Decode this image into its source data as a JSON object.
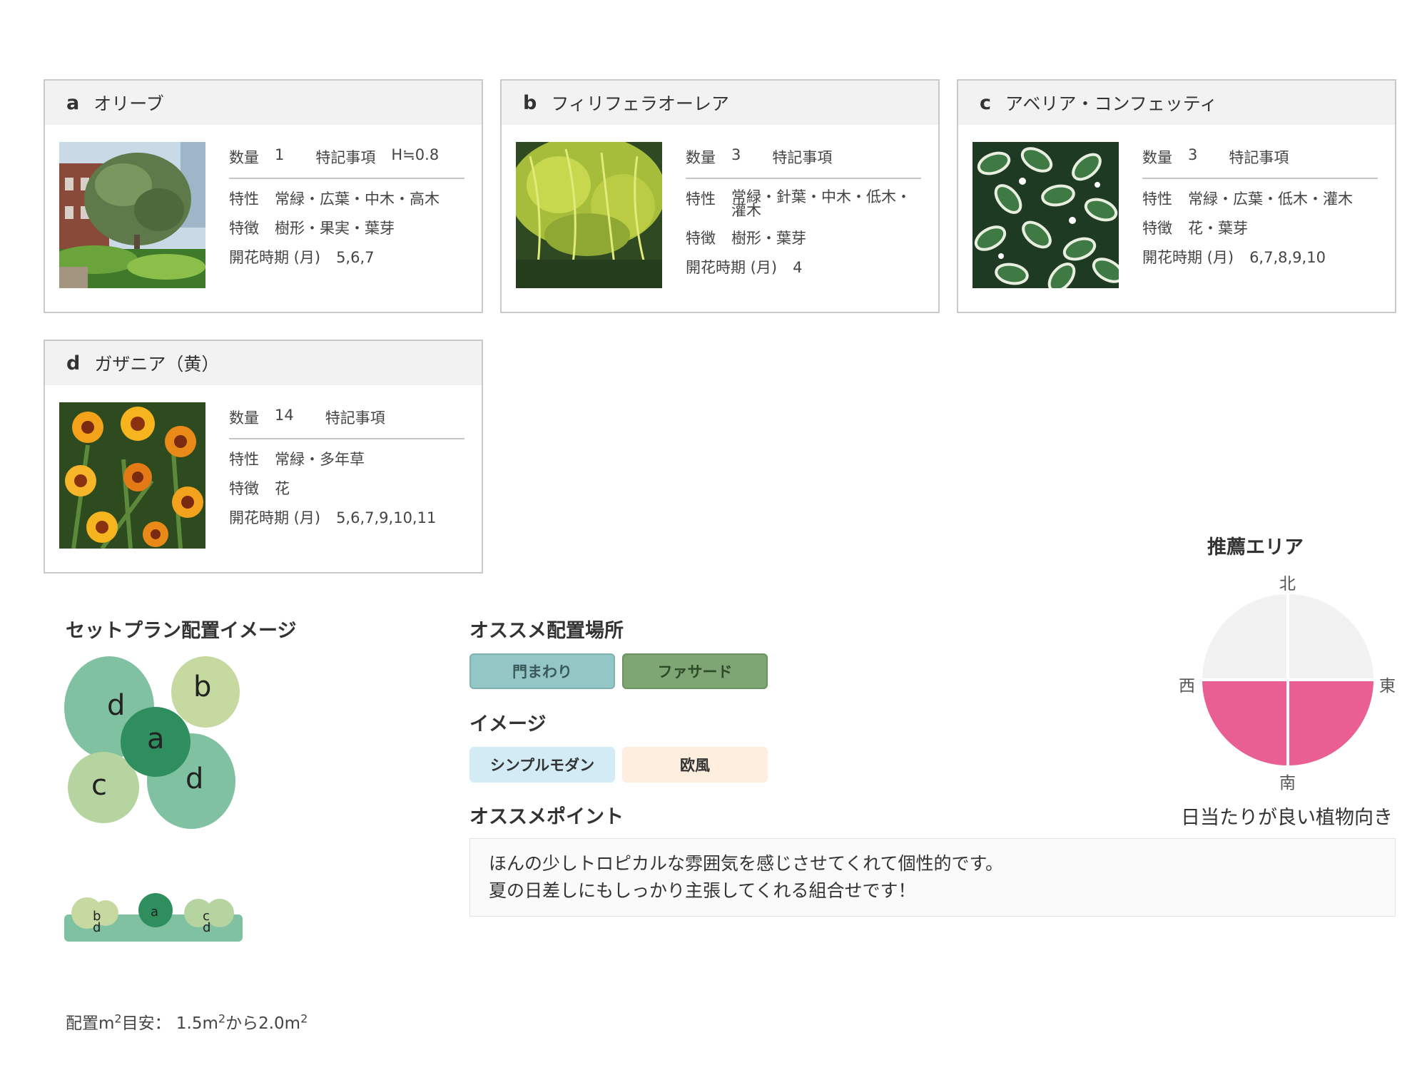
{
  "cards": [
    {
      "letter": "a",
      "name": "オリーブ",
      "qty_label": "数量",
      "qty": "1",
      "note_label": "特記事項",
      "note": "H≒0.8",
      "trait_label": "特性",
      "trait": "常緑・広葉・中木・高木",
      "feature_label": "特徴",
      "feature": "樹形・果実・葉芽",
      "bloom_label": "開花時期 (月)",
      "bloom": "5,6,7"
    },
    {
      "letter": "b",
      "name": "フィリフェラオーレア",
      "qty_label": "数量",
      "qty": "3",
      "note_label": "特記事項",
      "note": "",
      "trait_label": "特性",
      "trait": "常緑・針葉・中木・低木・灌木",
      "feature_label": "特徴",
      "feature": "樹形・葉芽",
      "bloom_label": "開花時期 (月)",
      "bloom": "4"
    },
    {
      "letter": "c",
      "name": "アベリア・コンフェッティ",
      "qty_label": "数量",
      "qty": "3",
      "note_label": "特記事項",
      "note": "",
      "trait_label": "特性",
      "trait": "常緑・広葉・低木・灌木",
      "feature_label": "特徴",
      "feature": "花・葉芽",
      "bloom_label": "開花時期 (月)",
      "bloom": "6,7,8,9,10"
    },
    {
      "letter": "d",
      "name": "ガザニア（黄）",
      "qty_label": "数量",
      "qty": "14",
      "note_label": "特記事項",
      "note": "",
      "trait_label": "特性",
      "trait": "常緑・多年草",
      "feature_label": "特徴",
      "feature": "花",
      "bloom_label": "開花時期 (月)",
      "bloom": "5,6,7,9,10,11"
    }
  ],
  "layout_section": {
    "title": "セットプラン配置イメージ",
    "plan_labels": {
      "a": "a",
      "b": "b",
      "c": "c",
      "d1": "d",
      "d2": "d"
    },
    "side_labels": {
      "b": "b",
      "d1": "d",
      "a": "a",
      "c": "c",
      "d2": "d"
    },
    "area_prefix": "配置m",
    "area_mid": "目安：  1.5m",
    "area_to": "から2.0m",
    "sup": "2"
  },
  "placement": {
    "title": "オススメ配置場所",
    "tags": [
      "門まわり",
      "ファサード"
    ],
    "colors": [
      "#94c6c6",
      "#7ea574"
    ]
  },
  "image_section": {
    "title": "イメージ",
    "tags": [
      "シンプルモダン",
      "欧風"
    ],
    "colors": [
      "#d3ebf5",
      "#fdeedd"
    ]
  },
  "point": {
    "title": "オススメポイント",
    "lines": [
      "ほんの少しトロピカルな雰囲気を感じさせてくれて個性的です。",
      "夏の日差しにもしっかり主張してくれる組合せです！"
    ]
  },
  "area": {
    "title": "推薦エリア",
    "north": "北",
    "south": "南",
    "east": "東",
    "west": "西",
    "caption": "日当たりが良い植物向き",
    "sunny_color": "#e95f93",
    "shade_color": "#f2f2f2"
  }
}
